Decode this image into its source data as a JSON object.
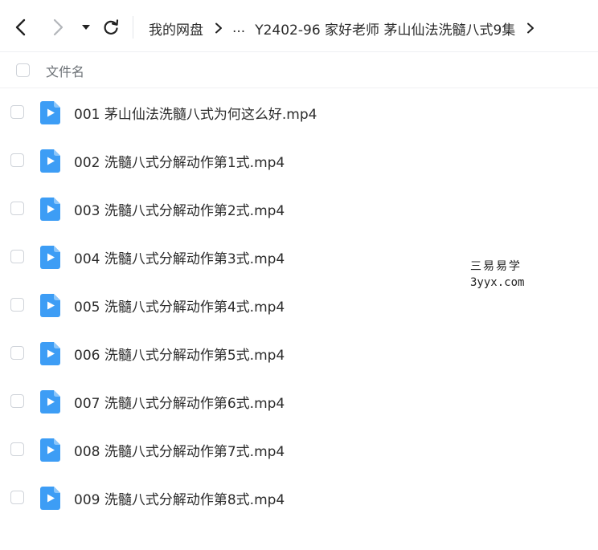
{
  "toolbar": {
    "back_icon": "chevron-left-icon",
    "forward_icon": "chevron-right-icon",
    "dropdown_icon": "caret-down-icon",
    "refresh_icon": "refresh-icon"
  },
  "breadcrumb": {
    "root": "我的网盘",
    "ellipsis": "...",
    "current": "Y2402-96 家好老师 茅山仙法洗髓八式9集"
  },
  "list_header": {
    "column_name": "文件名"
  },
  "files": [
    {
      "name": "001 茅山仙法洗髓八式为何这么好.mp4",
      "type": "video"
    },
    {
      "name": "002 洗髓八式分解动作第1式.mp4",
      "type": "video"
    },
    {
      "name": "003 洗髓八式分解动作第2式.mp4",
      "type": "video"
    },
    {
      "name": "004 洗髓八式分解动作第3式.mp4",
      "type": "video"
    },
    {
      "name": "005 洗髓八式分解动作第4式.mp4",
      "type": "video"
    },
    {
      "name": "006 洗髓八式分解动作第5式.mp4",
      "type": "video"
    },
    {
      "name": "007 洗髓八式分解动作第6式.mp4",
      "type": "video"
    },
    {
      "name": "008 洗髓八式分解动作第7式.mp4",
      "type": "video"
    },
    {
      "name": "009 洗髓八式分解动作第8式.mp4",
      "type": "video"
    }
  ],
  "watermark": {
    "line1": "三易易学",
    "line2": "3yyx.com"
  },
  "colors": {
    "video_icon": "#3d9df5",
    "text": "#2b2b2b",
    "muted": "#6b7075",
    "border": "#cfd3d9"
  }
}
